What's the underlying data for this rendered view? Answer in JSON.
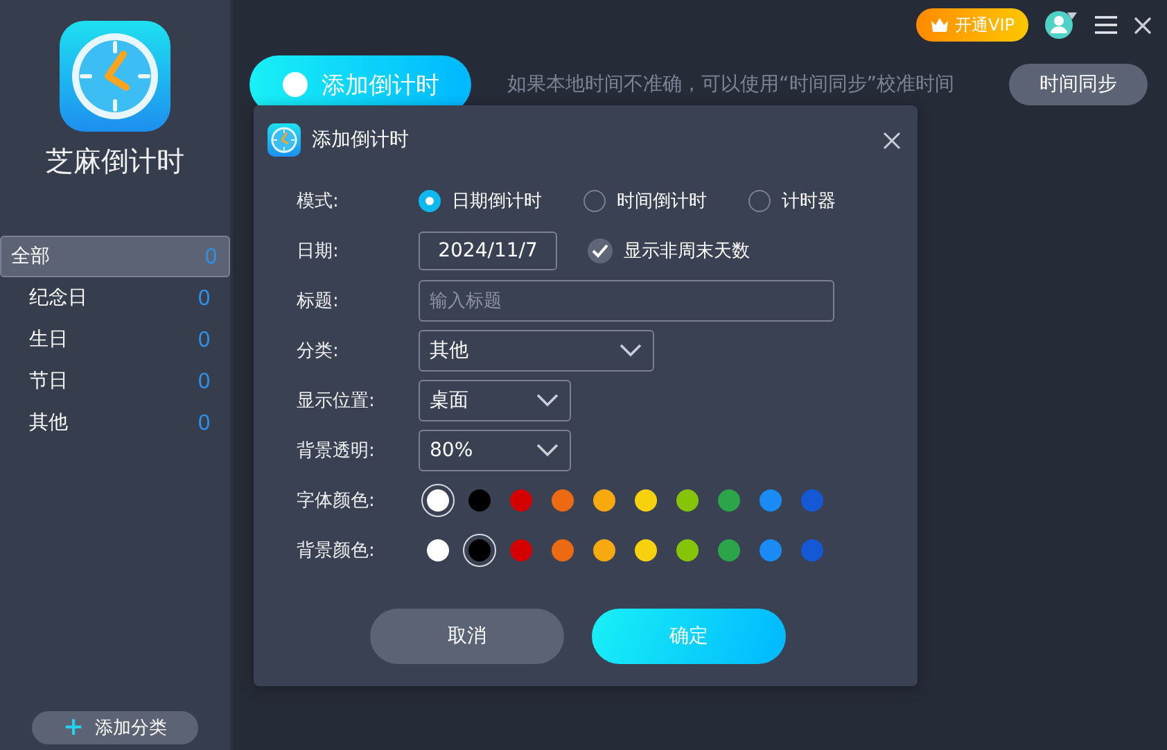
{
  "app": {
    "title": "芝麻倒计时"
  },
  "sidebar": {
    "items": [
      {
        "label": "全部",
        "count": "0",
        "selected": true
      },
      {
        "label": "纪念日",
        "count": "0",
        "selected": false
      },
      {
        "label": "生日",
        "count": "0",
        "selected": false
      },
      {
        "label": "节日",
        "count": "0",
        "selected": false
      },
      {
        "label": "其他",
        "count": "0",
        "selected": false
      }
    ],
    "add_button": {
      "icon": "+",
      "label": "添加分类"
    }
  },
  "topbar": {
    "vip_button": "开通VIP"
  },
  "toolbar": {
    "add_button": "添加倒计时",
    "hint": "如果本地时间不准确，可以使用“时间同步”校准时间",
    "sync_button": "时间同步"
  },
  "dialog": {
    "title": "添加倒计时",
    "mode": {
      "label": "模式:",
      "options": [
        {
          "label": "日期倒计时",
          "selected": true
        },
        {
          "label": "时间倒计时",
          "selected": false
        },
        {
          "label": "计时器",
          "selected": false
        }
      ]
    },
    "date": {
      "label": "日期:",
      "value": "2024/11/7",
      "weekday_option": {
        "label": "显示非周末天数",
        "checked": true
      }
    },
    "title_field": {
      "label": "标题:",
      "placeholder": "输入标题"
    },
    "category": {
      "label": "分类:",
      "value": "其他"
    },
    "position": {
      "label": "显示位置:",
      "value": "桌面"
    },
    "opacity": {
      "label": "背景透明:",
      "value": "80%"
    },
    "font_colors": {
      "label": "字体颜色:",
      "swatches": [
        {
          "color": "#ffffff",
          "selected": true
        },
        {
          "color": "#000000",
          "selected": false
        },
        {
          "color": "#d40000",
          "selected": false
        },
        {
          "color": "#eb6a12",
          "selected": false
        },
        {
          "color": "#f7a90f",
          "selected": false
        },
        {
          "color": "#f7d10e",
          "selected": false
        },
        {
          "color": "#86c408",
          "selected": false
        },
        {
          "color": "#2ba44a",
          "selected": false
        },
        {
          "color": "#1a8bf5",
          "selected": false
        },
        {
          "color": "#1558d6",
          "selected": false
        }
      ]
    },
    "bg_colors": {
      "label": "背景颜色:",
      "swatches": [
        {
          "color": "#ffffff",
          "selected": false
        },
        {
          "color": "#000000",
          "selected": true
        },
        {
          "color": "#d40000",
          "selected": false
        },
        {
          "color": "#eb6a12",
          "selected": false
        },
        {
          "color": "#f7a90f",
          "selected": false
        },
        {
          "color": "#f7d10e",
          "selected": false
        },
        {
          "color": "#86c408",
          "selected": false
        },
        {
          "color": "#2ba44a",
          "selected": false
        },
        {
          "color": "#1a8bf5",
          "selected": false
        },
        {
          "color": "#1558d6",
          "selected": false
        }
      ]
    },
    "buttons": [
      {
        "kind": "cancel",
        "label": "取消"
      },
      {
        "kind": "confirm",
        "label": "确定"
      }
    ]
  }
}
